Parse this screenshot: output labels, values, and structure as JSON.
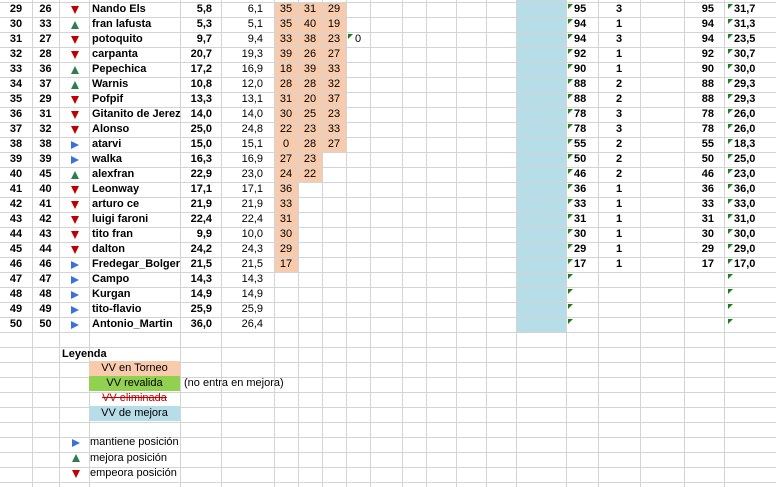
{
  "colors": {
    "tournament": "#f8cbad",
    "revalidated": "#92d050",
    "eliminated_text": "#c00000",
    "improvement": "#b7dde8",
    "maintains": "#3b6fe0",
    "improves": "#2e7d4f",
    "worsens": "#c00000",
    "comment_marker": "#1a7f1a"
  },
  "rows": [
    {
      "pos": "29",
      "prev": "26",
      "trend": "down",
      "name": "Nando Els",
      "v1": "5,8",
      "v2": "6,1",
      "t": [
        "35",
        "31",
        "29",
        ""
      ],
      "g1": "95",
      "g2": "3",
      "g3": "95",
      "g4": "31,7"
    },
    {
      "pos": "30",
      "prev": "33",
      "trend": "up",
      "name": "fran lafusta",
      "v1": "5,3",
      "v2": "5,1",
      "t": [
        "35",
        "40",
        "19",
        ""
      ],
      "g1": "94",
      "g2": "1",
      "g3": "94",
      "g4": "31,3"
    },
    {
      "pos": "31",
      "prev": "27",
      "trend": "down",
      "name": "potoquito",
      "v1": "9,7",
      "v2": "9,4",
      "t": [
        "33",
        "38",
        "23",
        "0"
      ],
      "g1": "94",
      "g2": "3",
      "g3": "94",
      "g4": "23,5"
    },
    {
      "pos": "32",
      "prev": "28",
      "trend": "down",
      "name": "carpanta",
      "v1": "20,7",
      "v2": "19,3",
      "t": [
        "39",
        "26",
        "27",
        ""
      ],
      "g1": "92",
      "g2": "1",
      "g3": "92",
      "g4": "30,7"
    },
    {
      "pos": "33",
      "prev": "36",
      "trend": "up",
      "name": "Pepechica",
      "v1": "17,2",
      "v2": "16,9",
      "t": [
        "18",
        "39",
        "33",
        ""
      ],
      "g1": "90",
      "g2": "1",
      "g3": "90",
      "g4": "30,0"
    },
    {
      "pos": "34",
      "prev": "37",
      "trend": "up",
      "name": "Warnis",
      "v1": "10,8",
      "v2": "12,0",
      "t": [
        "28",
        "28",
        "32",
        ""
      ],
      "g1": "88",
      "g2": "2",
      "g3": "88",
      "g4": "29,3"
    },
    {
      "pos": "35",
      "prev": "29",
      "trend": "down",
      "name": "Pofpif",
      "v1": "13,3",
      "v2": "13,1",
      "t": [
        "31",
        "20",
        "37",
        ""
      ],
      "g1": "88",
      "g2": "2",
      "g3": "88",
      "g4": "29,3"
    },
    {
      "pos": "36",
      "prev": "31",
      "trend": "down",
      "name": "Gitanito de Jerez",
      "v1": "14,0",
      "v2": "14,0",
      "t": [
        "30",
        "25",
        "23",
        ""
      ],
      "g1": "78",
      "g2": "3",
      "g3": "78",
      "g4": "26,0"
    },
    {
      "pos": "37",
      "prev": "32",
      "trend": "down",
      "name": "Alonso",
      "v1": "25,0",
      "v2": "24,8",
      "t": [
        "22",
        "23",
        "33",
        ""
      ],
      "g1": "78",
      "g2": "3",
      "g3": "78",
      "g4": "26,0"
    },
    {
      "pos": "38",
      "prev": "38",
      "trend": "right",
      "name": "atarvi",
      "v1": "15,0",
      "v2": "15,1",
      "t": [
        "0",
        "28",
        "27",
        ""
      ],
      "g1": "55",
      "g2": "2",
      "g3": "55",
      "g4": "18,3"
    },
    {
      "pos": "39",
      "prev": "39",
      "trend": "right",
      "name": "walka",
      "v1": "16,3",
      "v2": "16,9",
      "t": [
        "27",
        "23",
        "",
        ""
      ],
      "g1": "50",
      "g2": "2",
      "g3": "50",
      "g4": "25,0"
    },
    {
      "pos": "40",
      "prev": "45",
      "trend": "up",
      "name": "alexfran",
      "v1": "22,9",
      "v2": "23,0",
      "t": [
        "24",
        "22",
        "",
        ""
      ],
      "g1": "46",
      "g2": "2",
      "g3": "46",
      "g4": "23,0"
    },
    {
      "pos": "41",
      "prev": "40",
      "trend": "down",
      "name": "Leonway",
      "v1": "17,1",
      "v2": "17,1",
      "t": [
        "36",
        "",
        "",
        ""
      ],
      "g1": "36",
      "g2": "1",
      "g3": "36",
      "g4": "36,0"
    },
    {
      "pos": "42",
      "prev": "41",
      "trend": "down",
      "name": "arturo ce",
      "v1": "21,9",
      "v2": "21,9",
      "t": [
        "33",
        "",
        "",
        ""
      ],
      "g1": "33",
      "g2": "1",
      "g3": "33",
      "g4": "33,0"
    },
    {
      "pos": "43",
      "prev": "42",
      "trend": "down",
      "name": "luigi faroni",
      "v1": "22,4",
      "v2": "22,4",
      "t": [
        "31",
        "",
        "",
        ""
      ],
      "g1": "31",
      "g2": "1",
      "g3": "31",
      "g4": "31,0"
    },
    {
      "pos": "44",
      "prev": "43",
      "trend": "down",
      "name": "tito fran",
      "v1": "9,9",
      "v2": "10,0",
      "t": [
        "30",
        "",
        "",
        ""
      ],
      "g1": "30",
      "g2": "1",
      "g3": "30",
      "g4": "30,0"
    },
    {
      "pos": "45",
      "prev": "44",
      "trend": "down",
      "name": "dalton",
      "v1": "24,2",
      "v2": "24,3",
      "t": [
        "29",
        "",
        "",
        ""
      ],
      "g1": "29",
      "g2": "1",
      "g3": "29",
      "g4": "29,0"
    },
    {
      "pos": "46",
      "prev": "46",
      "trend": "right",
      "name": "Fredegar_Bolger",
      "v1": "21,5",
      "v2": "21,5",
      "t": [
        "17",
        "",
        "",
        ""
      ],
      "g1": "17",
      "g2": "1",
      "g3": "17",
      "g4": "17,0"
    },
    {
      "pos": "47",
      "prev": "47",
      "trend": "right",
      "name": "Campo",
      "v1": "14,3",
      "v2": "14,3",
      "t": [
        "",
        "",
        "",
        ""
      ],
      "g1": "",
      "g2": "",
      "g3": "",
      "g4": ""
    },
    {
      "pos": "48",
      "prev": "48",
      "trend": "right",
      "name": "Kurgan",
      "v1": "14,9",
      "v2": "14,9",
      "t": [
        "",
        "",
        "",
        ""
      ],
      "g1": "",
      "g2": "",
      "g3": "",
      "g4": ""
    },
    {
      "pos": "49",
      "prev": "49",
      "trend": "right",
      "name": "tito-flavio",
      "v1": "25,9",
      "v2": "25,9",
      "t": [
        "",
        "",
        "",
        ""
      ],
      "g1": "",
      "g2": "",
      "g3": "",
      "g4": ""
    },
    {
      "pos": "50",
      "prev": "50",
      "trend": "right",
      "name": "Antonio_Martin",
      "v1": "36,0",
      "v2": "26,4",
      "t": [
        "",
        "",
        "",
        ""
      ],
      "g1": "",
      "g2": "",
      "g3": "",
      "g4": ""
    }
  ],
  "legend": {
    "title": "Leyenda",
    "tournament": "VV en Torneo",
    "revalidated": "VV revalida",
    "revalidated_note": "(no entra en mejora)",
    "eliminated": "VV eliminada",
    "improvement": "VV de mejora",
    "maintains": "mantiene posición",
    "improves": "mejora posición",
    "worsens": "empeora posición"
  }
}
